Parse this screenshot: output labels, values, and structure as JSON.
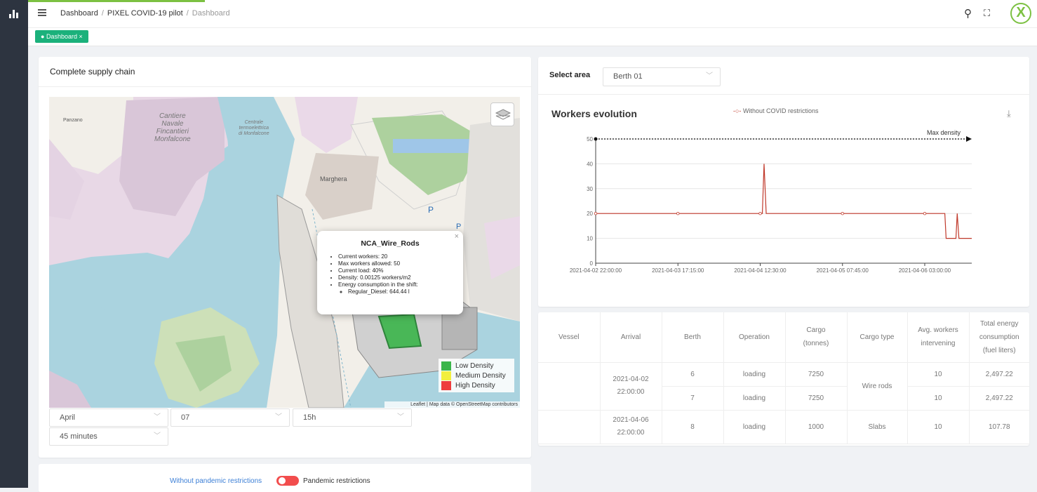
{
  "breadcrumb": {
    "item1": "Dashboard",
    "item2": "PIXEL COVID-19 pilot",
    "current": "Dashboard"
  },
  "tag": {
    "label": "Dashboard"
  },
  "supply_chain": {
    "title": "Complete supply chain",
    "map_labels": {
      "cantiere": "Cantiere\nNavale\nFincantieri\nMonfalcone",
      "centrale": "Centrale\ntermoelettrica\ndi Monfalcone",
      "panzano": "Panzano",
      "marghera": "Marghera",
      "parking": "P"
    },
    "popup": {
      "title": "NCA_Wire_Rods",
      "current_workers": "Current workers: 20",
      "max_workers": "Max workers allowed: 50",
      "current_load": "Current load: 40%",
      "density": "Density: 0.00125 workers/m2",
      "energy": "Energy consumption in the shift:",
      "energy_item": "Regular_Diesel: 644.44 l",
      "close": "×"
    },
    "legend": {
      "low": "Low Density",
      "medium": "Medium Density",
      "high": "High Density"
    },
    "attribution": "Leaflet | Map data © OpenStreetMap contributors",
    "selects": {
      "month": "April",
      "day": "07",
      "hour": "15h",
      "interval": "45 minutes"
    }
  },
  "select_area": {
    "label": "Select area",
    "value": "Berth 01"
  },
  "workers_chart": {
    "title": "Workers evolution",
    "legend_label": "Without COVID restrictions",
    "max_density_label": "Max density"
  },
  "chart_data": {
    "type": "line",
    "x_tick_labels": [
      "2021-04-02 22:00:00",
      "2021-04-03 17:15:00",
      "2021-04-04 12:30:00",
      "2021-04-05 07:45:00",
      "2021-04-06 03:00:00"
    ],
    "y_ticks": [
      0,
      10,
      20,
      30,
      40,
      50
    ],
    "ylim": [
      0,
      50
    ],
    "series": [
      {
        "name": "Without COVID restrictions",
        "color": "#c0392b",
        "x_hours": [
          0,
          19.25,
          38.5,
          39.0,
          39.4,
          39.9,
          57.75,
          77.0,
          81.7,
          82.0,
          84.3,
          84.6,
          85.0,
          88.0
        ],
        "values": [
          20,
          20,
          20,
          20,
          40,
          20,
          20,
          20,
          20,
          10,
          10,
          20,
          10,
          10
        ]
      }
    ],
    "max_density": 50
  },
  "cargo_table": {
    "headers": [
      "Vessel",
      "Arrival",
      "Berth",
      "Operation",
      "Cargo\n(tonnes)",
      "Cargo type",
      "Avg. workers\nintervening",
      "Total energy\nconsumption\n(fuel liters)"
    ],
    "rows": [
      {
        "vessel": "",
        "arrival": "2021-04-02\n22:00:00",
        "berth": "6",
        "operation": "loading",
        "cargo": "7250",
        "cargo_type": "Wire rods",
        "workers": "10",
        "energy": "2,497.22"
      },
      {
        "vessel": "",
        "arrival": "",
        "berth": "7",
        "operation": "loading",
        "cargo": "7250",
        "cargo_type": "",
        "workers": "10",
        "energy": "2,497.22"
      },
      {
        "vessel": "",
        "arrival": "2021-04-06\n22:00:00",
        "berth": "8",
        "operation": "loading",
        "cargo": "1000",
        "cargo_type": "Slabs",
        "workers": "10",
        "energy": "107.78"
      }
    ]
  },
  "restrictions_toggle": {
    "left_label": "Without pandemic restrictions",
    "right_label": "Pandemic restrictions"
  }
}
